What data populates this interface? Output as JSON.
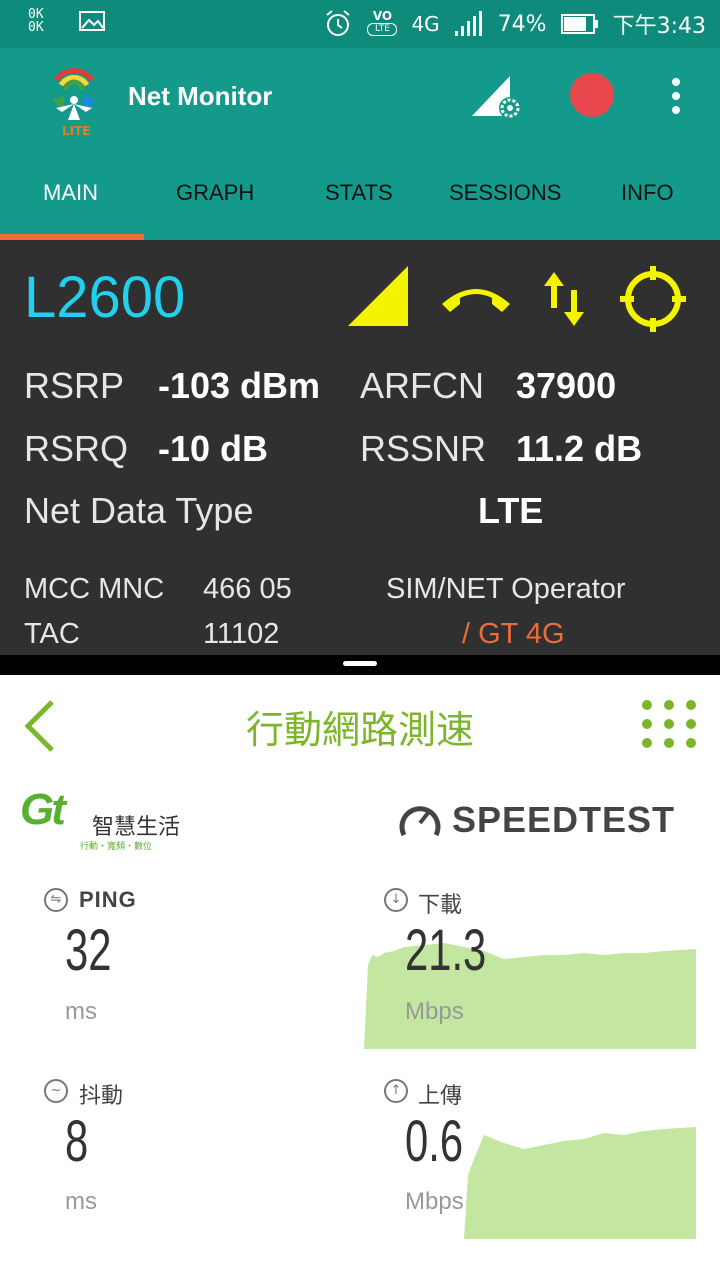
{
  "status_bar": {
    "ok_top": "0K",
    "ok_bottom": "0K",
    "network": "4G",
    "volte": "VO",
    "volte_sub": "LTE",
    "battery": "74%",
    "time": "下午3:43"
  },
  "app_bar": {
    "title": "Net Monitor",
    "logo_badge": "LITE",
    "record_color": "#e8474e"
  },
  "tabs": [
    {
      "label": "MAIN",
      "active": true
    },
    {
      "label": "GRAPH",
      "active": false
    },
    {
      "label": "STATS",
      "active": false
    },
    {
      "label": "SESSIONS",
      "active": false
    },
    {
      "label": "INFO",
      "active": false
    }
  ],
  "cell": {
    "band": "L2600",
    "rsrp_label": "RSRP",
    "rsrp_value": "-103 dBm",
    "arfcn_label": "ARFCN",
    "arfcn_value": "37900",
    "rsrq_label": "RSRQ",
    "rsrq_value": "-10 dB",
    "rssnr_label": "RSSNR",
    "rssnr_value": "11.2 dB",
    "net_type_label": "Net Data Type",
    "net_type_value": "LTE",
    "mcc_label": "MCC MNC",
    "mcc_value": "466 05",
    "sim_label": "SIM/NET Operator",
    "tac_label": "TAC",
    "tac_value": "11102",
    "operator_value": "/ GT 4G"
  },
  "speedtest": {
    "title": "行動網路測速",
    "brand_logo": "Gt",
    "brand_name": "智慧生活",
    "brand_tagline": "行動・寬頻・數位",
    "provider": "SPEEDTEST",
    "ping_label": "PING",
    "ping_value": "32",
    "ping_unit": "ms",
    "download_label": "下載",
    "download_value": "21.3",
    "download_unit": "Mbps",
    "jitter_label": "抖動",
    "jitter_value": "8",
    "jitter_unit": "ms",
    "upload_label": "上傳",
    "upload_value": "0.6",
    "upload_unit": "Mbps",
    "graph_color": "#c3e7a0",
    "accent_color": "#7cb52a"
  }
}
